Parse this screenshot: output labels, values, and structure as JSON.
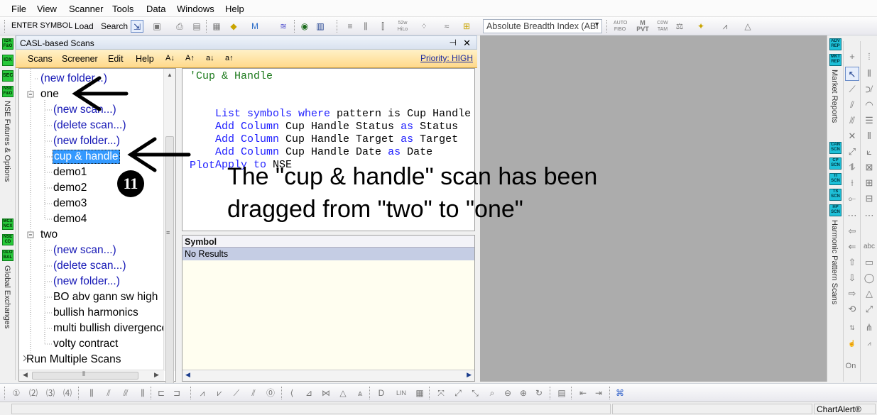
{
  "menu": [
    "File",
    "View",
    "Scanner",
    "Tools",
    "Data",
    "Windows",
    "Help"
  ],
  "toolbar": {
    "enter_symbol": "ENTER SYMBOL",
    "load": "Load",
    "search": "Search",
    "indicator_combo": "Absolute Breadth Index (ABI"
  },
  "left_strip": {
    "badges_top": [
      "IDX F&O",
      "IDX",
      "SEC",
      "NSE F&O"
    ],
    "label_top": "NSE Futures & Options",
    "badges_bottom": [
      "MCX NCX",
      "NSE CD",
      "GLO BAL"
    ],
    "label_bottom": "Global Exchanges"
  },
  "panel": {
    "title": "CASL-based Scans",
    "pin": "⊣",
    "close": "✕",
    "menu": [
      "Scans",
      "Screener",
      "Edit",
      "Help"
    ],
    "priority": "Priority: HIGH"
  },
  "tree": {
    "items": [
      {
        "text": "(new folder...)",
        "type": "action"
      },
      {
        "text": "one",
        "type": "folder"
      },
      {
        "text": "(new scan...)",
        "type": "action"
      },
      {
        "text": "(delete scan...)",
        "type": "action"
      },
      {
        "text": "(new folder...)",
        "type": "action"
      },
      {
        "text": "cup & handle",
        "type": "selected"
      },
      {
        "text": "demo1",
        "type": "scan"
      },
      {
        "text": "demo2",
        "type": "scan"
      },
      {
        "text": "demo3",
        "type": "scan"
      },
      {
        "text": "demo4",
        "type": "scan"
      },
      {
        "text": "two",
        "type": "folder"
      },
      {
        "text": "(new scan...)",
        "type": "action"
      },
      {
        "text": "(delete scan...)",
        "type": "action"
      },
      {
        "text": "(new folder...)",
        "type": "action"
      },
      {
        "text": "BO abv gann sw high",
        "type": "scan"
      },
      {
        "text": "bullish harmonics",
        "type": "scan"
      },
      {
        "text": "multi bullish divergence",
        "type": "scan"
      },
      {
        "text": "volty contract",
        "type": "scan"
      },
      {
        "text": "Run Multiple Scans",
        "type": "root"
      }
    ]
  },
  "editor": {
    "line1": "'Cup & Handle",
    "line3_kw": "List symbols where",
    "line3_rest": " pattern is Cup Handle",
    "line4_kw": "Add Column",
    "line4_mid": " Cup Handle Status ",
    "line4_as": "as",
    "line4_end": " Status",
    "line5_kw": "Add Column",
    "line5_mid": " Cup Handle Target ",
    "line5_as": "as",
    "line5_end": " Target",
    "line6_kw": "Add Column",
    "line6_mid": " Cup Handle Date ",
    "line6_as": "as",
    "line6_end": " Date",
    "line7_kw": "Apply to",
    "line7_end": " NSE",
    "line8_kw": "Plot"
  },
  "results": {
    "column": "Symbol",
    "row": "No Results"
  },
  "annotation": {
    "step_number": "11",
    "line1": "The \"cup & handle\" scan has been",
    "line2": "dragged from \"two\" to \"one\""
  },
  "right_panel": {
    "badges_top": [
      "ADV REP",
      "MKT REP"
    ],
    "label_top": "Market Reports",
    "badges_bottom": [
      "CAN SCN",
      "CP SCN",
      "TI SCN",
      "TS SCN",
      "HP SCN"
    ],
    "label_bottom": "Harmonic Pattern Scans",
    "tool_text1": "abc",
    "tool_text2": "On"
  },
  "status": {
    "brand": "ChartAlert®"
  }
}
